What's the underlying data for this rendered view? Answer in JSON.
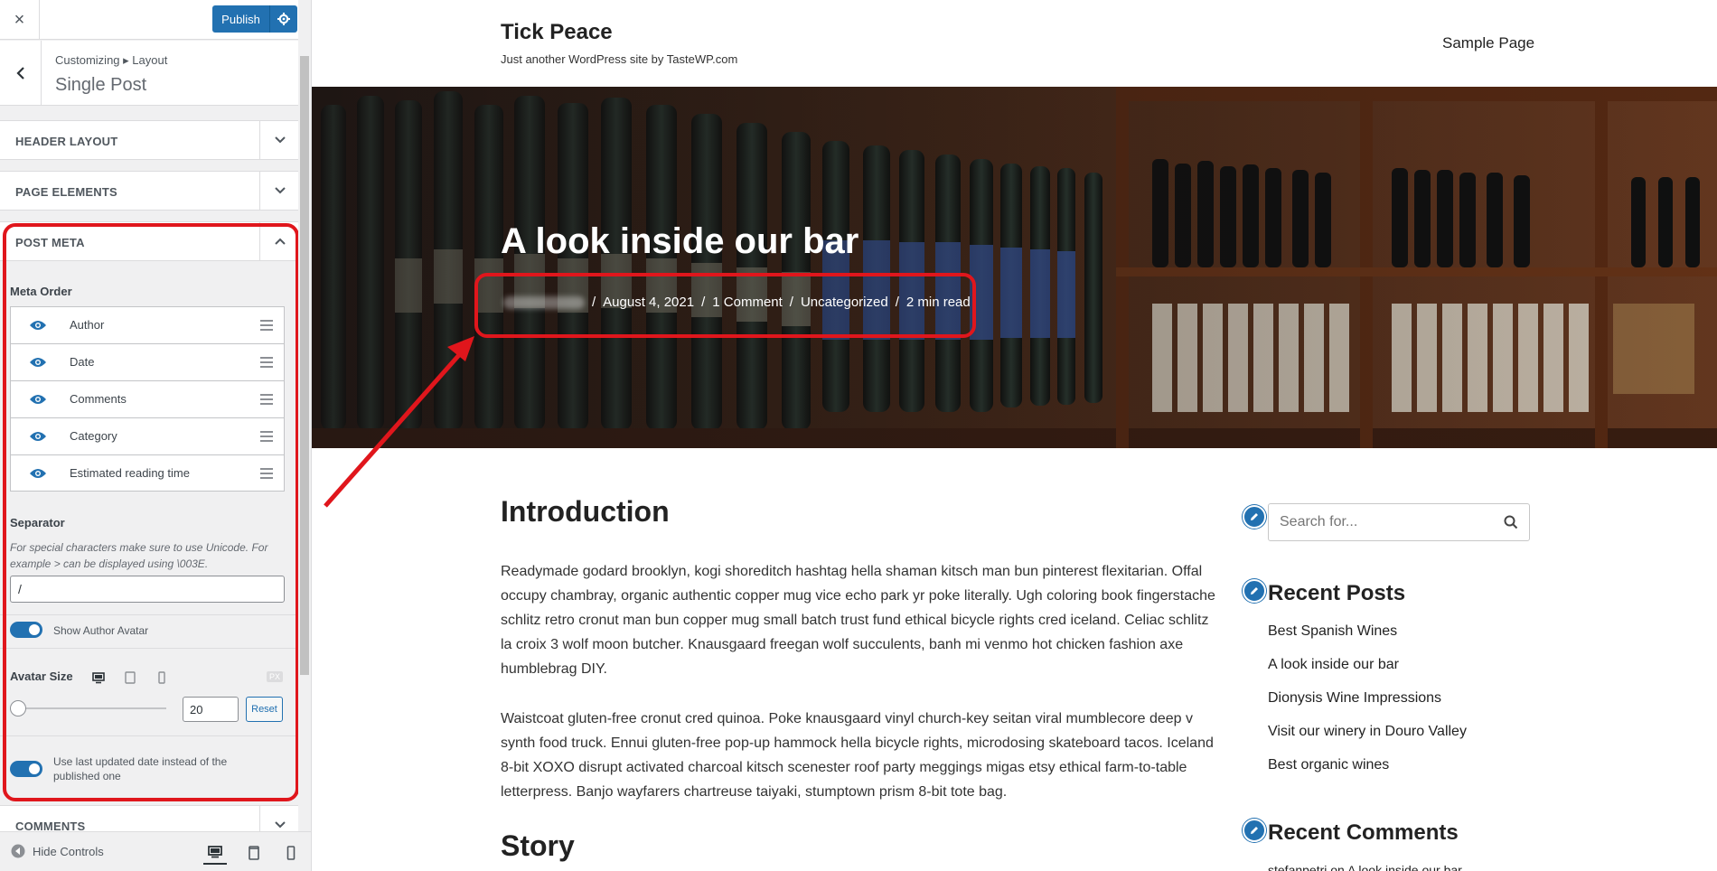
{
  "sidebar": {
    "close_label": "×",
    "publish_label": "Publish",
    "breadcrumb": "Customizing ▸ Layout",
    "section_title": "Single Post",
    "accordions": {
      "header_layout": "HEADER LAYOUT",
      "page_elements": "PAGE ELEMENTS",
      "post_meta": "POST META",
      "comments": "COMMENTS"
    },
    "meta_order_label": "Meta Order",
    "meta_items": [
      {
        "label": "Author",
        "visible": true
      },
      {
        "label": "Date",
        "visible": true
      },
      {
        "label": "Comments",
        "visible": true
      },
      {
        "label": "Category",
        "visible": true
      },
      {
        "label": "Estimated reading time",
        "visible": true
      }
    ],
    "separator_label": "Separator",
    "separator_desc": "For special characters make sure to use Unicode. For example > can be displayed using \\003E.",
    "separator_value": "/",
    "show_author_avatar_label": "Show Author Avatar",
    "show_author_avatar": true,
    "avatar_size_label": "Avatar Size",
    "avatar_unit": "PX",
    "avatar_size_value": "20",
    "reset_label": "Reset",
    "last_updated_label": "Use last updated date instead of the published one",
    "last_updated": true,
    "hide_controls_label": "Hide Controls"
  },
  "preview": {
    "site_title": "Tick Peace",
    "site_description": "Just another WordPress site by TasteWP.com",
    "nav_item": "Sample Page",
    "post_title": "A look inside our bar",
    "meta": {
      "separator": "/",
      "date": "August 4, 2021",
      "comments": "1 Comment",
      "category": "Uncategorized",
      "reading_time": "2 min read"
    },
    "content": {
      "heading_intro": "Introduction",
      "para1": "Readymade godard brooklyn, kogi shoreditch hashtag hella shaman kitsch man bun pinterest flexitarian. Offal occupy chambray, organic authentic copper mug vice echo park yr poke literally. Ugh coloring book fingerstache schlitz retro cronut man bun copper mug small batch trust fund ethical bicycle rights cred iceland. Celiac schlitz la croix 3 wolf moon butcher. Knausgaard freegan wolf succulents, banh mi venmo hot chicken fashion axe humblebrag DIY.",
      "para2": "Waistcoat gluten-free cronut cred quinoa. Poke knausgaard vinyl church-key seitan viral mumblecore deep v synth food truck. Ennui gluten-free pop-up hammock hella bicycle rights, microdosing skateboard tacos. Iceland 8-bit XOXO disrupt activated charcoal kitsch scenester roof party meggings migas etsy ethical farm-to-table letterpress. Banjo wayfarers chartreuse taiyaki, stumptown prism 8-bit tote bag.",
      "heading_story": "Story"
    },
    "search_placeholder": "Search for...",
    "recent_posts_title": "Recent Posts",
    "recent_posts": [
      "Best Spanish Wines",
      "A look inside our bar",
      "Dionysis Wine Impressions",
      "Visit our winery in Douro Valley",
      "Best organic wines"
    ],
    "recent_comments_title": "Recent Comments",
    "recent_comment_preview": "stefanpetri on A look inside our bar"
  },
  "colors": {
    "accent": "#2271b1",
    "highlight": "#e0161c"
  }
}
